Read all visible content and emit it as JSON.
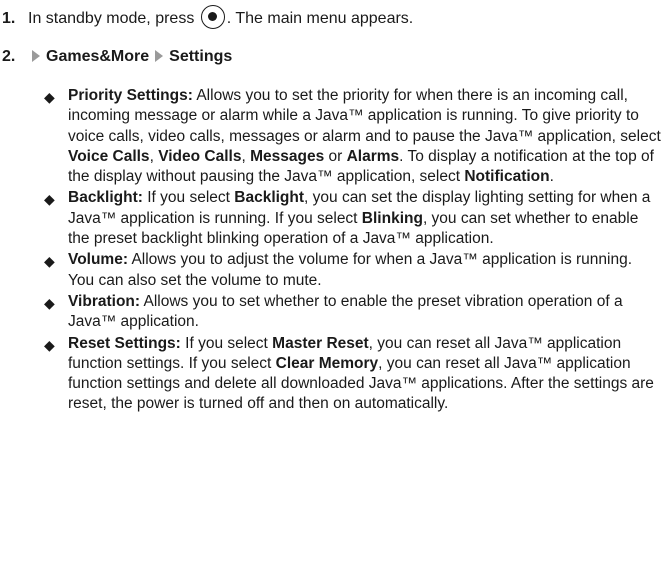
{
  "steps": [
    {
      "num": "1.",
      "before": "In standby mode, press",
      "after": ". The main menu appears."
    },
    {
      "num": "2.",
      "path": [
        "Games&More",
        "Settings"
      ]
    }
  ],
  "icons": {
    "key": "center-select-key-icon",
    "arrow": "right-triangle-arrow-icon",
    "bullet": "diamond-bullet-icon"
  },
  "bullets": [
    {
      "term": "Priority Settings:",
      "t1": " Allows you to set the priority for when there is an incoming call, incoming message or alarm while a Java™ application is running. To give priority to voice calls, video calls, messages or alarm and to pause the Java™ application, select ",
      "o1": "Voice Calls",
      "t2": ", ",
      "o2": "Video Calls",
      "t3": ", ",
      "o3": "Messages",
      "t4": " or ",
      "o4": "Alarms",
      "t5": ". To display a notification at the top of the display without pausing the Java™ application, select ",
      "o5": "Notification",
      "t6": "."
    },
    {
      "term": "Backlight:",
      "t1": " If you select ",
      "o1": "Backlight",
      "t2": ", you can set the display lighting setting for when a Java™ application is running. If you select ",
      "o2": "Blinking",
      "t3": ", you can set whether to enable the preset backlight blinking operation of a Java™ application."
    },
    {
      "term": "Volume:",
      "t1": " Allows you to adjust the volume for when a Java™ application is running. You can also set the volume to mute."
    },
    {
      "term": "Vibration:",
      "t1": " Allows you to set whether to enable the preset vibration operation of a Java™ application."
    },
    {
      "term": "Reset Settings:",
      "t1": " If you select ",
      "o1": "Master Reset",
      "t2": ", you can reset all Java™ application function settings. If you select ",
      "o2": "Clear Memory",
      "t3": ", you can reset all Java™ application function settings and delete all downloaded Java™ applications. After the settings are reset, the power is turned off and then on automatically."
    }
  ]
}
